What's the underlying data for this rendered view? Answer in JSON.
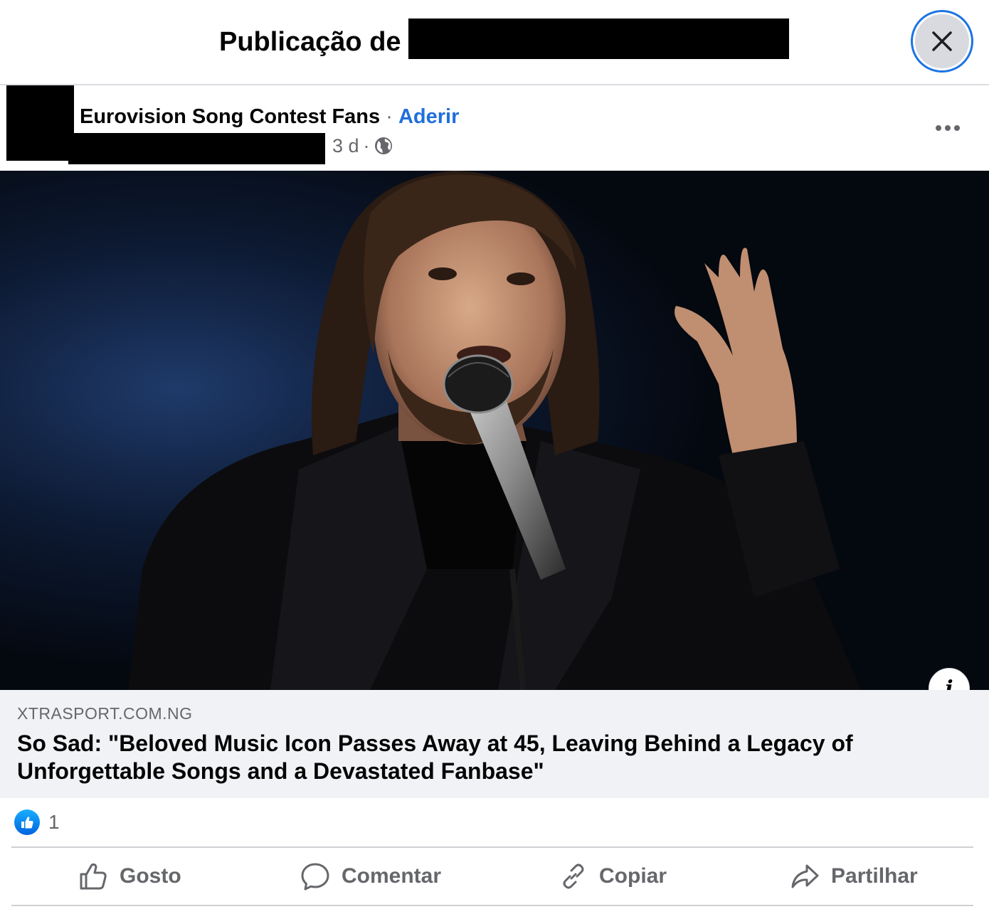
{
  "header": {
    "title": "Publicação de"
  },
  "post": {
    "group_name": "Eurovision Song Contest Fans",
    "separator": "·",
    "join_label": "Aderir",
    "time": "3 d",
    "time_separator": "·",
    "audience_icon": "globe-icon",
    "more_icon": "more-horizontal-icon"
  },
  "link": {
    "domain": "XTRASPORT.COM.NG",
    "title": "So Sad: \"Beloved Music Icon Passes Away at 45, Leaving Behind a Legacy of Unforgettable Songs and a Devastated Fanbase\"",
    "info_label": "i"
  },
  "reactions": {
    "icon": "like-reaction-icon",
    "count": "1"
  },
  "actions": {
    "like": "Gosto",
    "comment": "Comentar",
    "copy": "Copiar",
    "share": "Partilhar"
  },
  "colors": {
    "accent": "#1b74e4",
    "link_blue": "#216fdb",
    "muted_text": "#65676b",
    "preview_bg": "#f0f2f5"
  }
}
